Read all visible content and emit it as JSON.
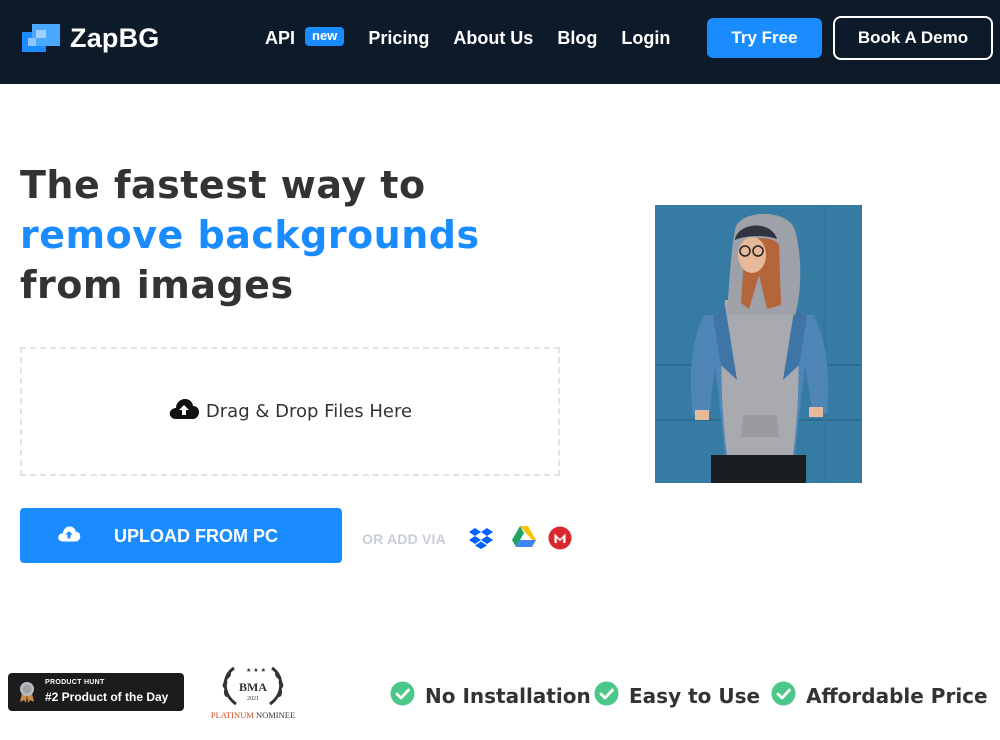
{
  "nav": {
    "brand": "ZapBG",
    "links": [
      {
        "label": "API",
        "badge": "new"
      },
      {
        "label": "Pricing"
      },
      {
        "label": "About Us"
      },
      {
        "label": "Blog"
      },
      {
        "label": "Login"
      }
    ],
    "try_free": "Try Free",
    "book_demo": "Book A Demo"
  },
  "hero": {
    "line1": "The fastest way to",
    "line2": "remove backgrounds",
    "line3": "from images"
  },
  "upload": {
    "dropzone_label": "Drag & Drop Files Here",
    "upload_button": "UPLOAD FROM PC",
    "or_add_via": "OR ADD VIA",
    "sources": [
      "dropbox-icon",
      "google-drive-icon",
      "mega-icon"
    ]
  },
  "badges": {
    "producthunt_small": "PRODUCT HUNT",
    "producthunt_main": "#2 Product of the Day",
    "bma_letters": "BMA",
    "bma_year": "2021",
    "bma_platinum": "PLATINUM",
    "bma_nominee": "NOMINEE"
  },
  "features": [
    "No Installation",
    "Easy to Use",
    "Affordable Price"
  ],
  "colors": {
    "nav_bg": "#0c1a2a",
    "accent": "#1a8cff",
    "text": "#333333",
    "check": "#4bc78a"
  }
}
